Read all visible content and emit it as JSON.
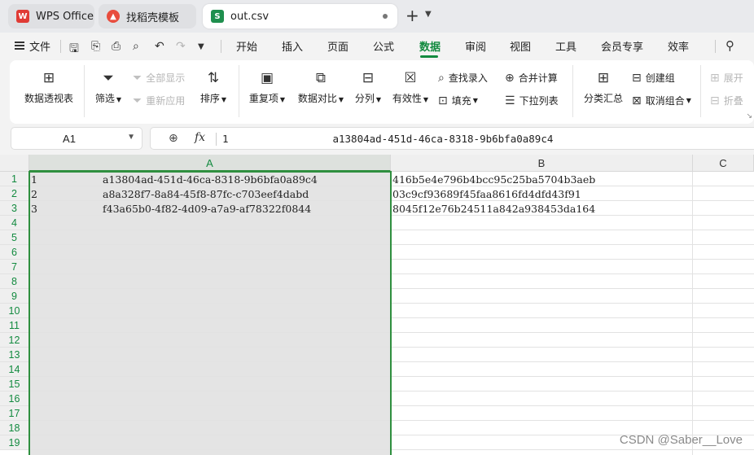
{
  "tabs": [
    {
      "label": "WPS Office",
      "icon": "wps-logo-icon"
    },
    {
      "label": "找稻壳模板",
      "icon": "daoke-logo-icon"
    },
    {
      "label": "out.csv",
      "icon": "spreadsheet-file-icon",
      "icon_text": "S",
      "active": true
    }
  ],
  "menu": {
    "file_label": "文件",
    "items": [
      "开始",
      "插入",
      "页面",
      "公式",
      "数据",
      "审阅",
      "视图",
      "工具",
      "会员专享",
      "效率"
    ],
    "active": "数据",
    "accent_color": "#128a3f"
  },
  "ribbon": {
    "pivot": "数据透视表",
    "filter": "筛选",
    "show_all": "全部显示",
    "reapply": "重新应用",
    "sort": "排序",
    "duplicates": "重复项",
    "compare": "数据对比",
    "split": "分列",
    "validity": "有效性",
    "find_entry": "查找录入",
    "fill": "填充",
    "merge_calc": "合并计算",
    "dropdown_list": "下拉列表",
    "subtotal": "分类汇总",
    "create_group": "创建组",
    "ungroup": "取消组合",
    "expand": "展开",
    "collapse": "折叠"
  },
  "formula_bar": {
    "cell_ref": "A1",
    "fx": "fx",
    "value": "1                 a13804ad-451d-46ca-8318-9b6bfa0a89c4"
  },
  "sheet": {
    "columns": [
      "A",
      "B",
      "C"
    ],
    "selected_column": "A",
    "row_numbers": [
      "1",
      "2",
      "3",
      "4",
      "5",
      "6",
      "7",
      "8",
      "9",
      "10",
      "11",
      "12",
      "13",
      "14",
      "15",
      "16",
      "17",
      "18",
      "19"
    ],
    "rows": [
      {
        "num": "1",
        "uuid": "a13804ad-451d-46ca-8318-9b6bfa0a89c4",
        "hash": "416b5e4e796b4bcc95c25ba5704b3aeb"
      },
      {
        "num": "2",
        "uuid": "a8a328f7-8a84-45f8-87fc-c703eef4dabd",
        "hash": "03c9cf93689f45faa8616fd4dfd43f91"
      },
      {
        "num": "3",
        "uuid": "f43a65b0-4f82-4d09-a7a9-af78322f0844",
        "hash": "8045f12e76b24511a842a938453da164"
      }
    ]
  },
  "watermark": "CSDN @Saber__Love"
}
